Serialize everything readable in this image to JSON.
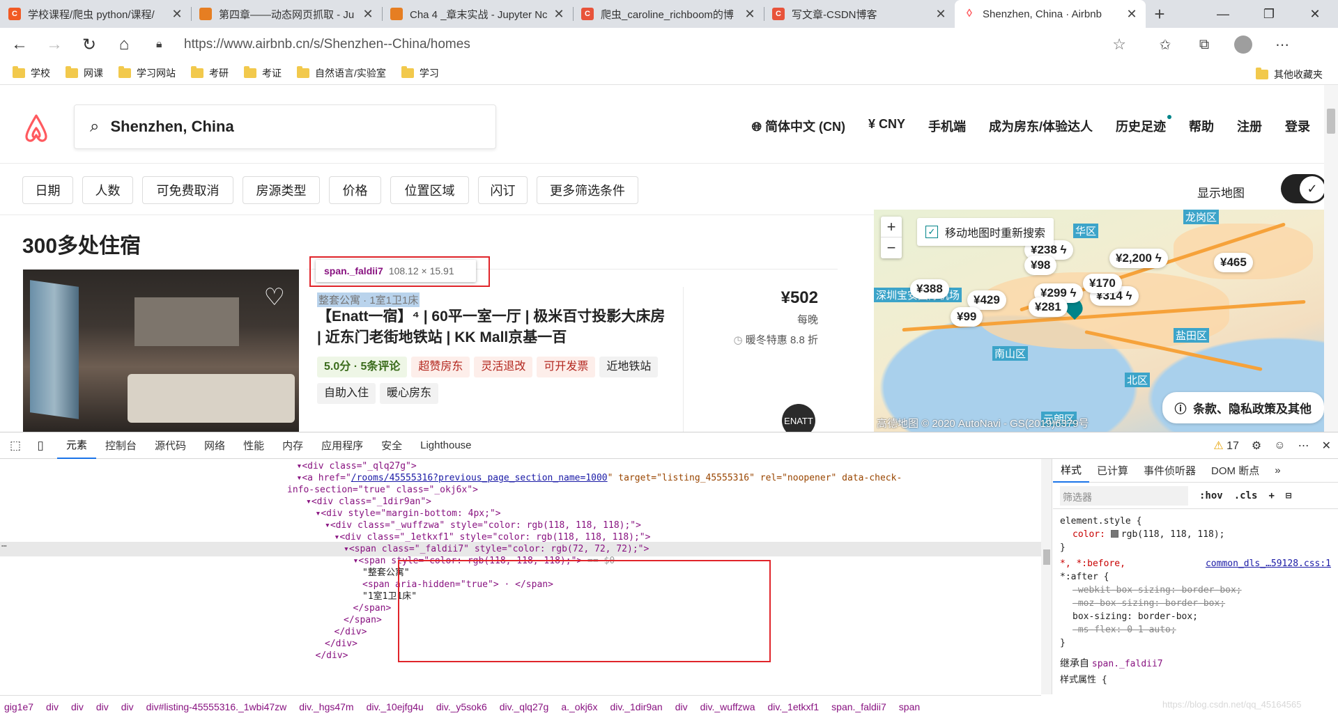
{
  "browser": {
    "tabs": [
      {
        "title": "学校课程/爬虫 python/课程/",
        "fav_color": "#f15a24",
        "fav_glyph": "C"
      },
      {
        "title": "第四章——动态网页抓取 - Ju",
        "fav_color": "#e67e22",
        "fav_glyph": ""
      },
      {
        "title": "Cha 4 _章末实战 - Jupyter Nc",
        "fav_color": "#e67e22",
        "fav_glyph": ""
      },
      {
        "title": "爬虫_caroline_richboom的博",
        "fav_color": "#e8533a",
        "fav_glyph": "C"
      },
      {
        "title": "写文章-CSDN博客",
        "fav_color": "#e8533a",
        "fav_glyph": "C"
      },
      {
        "title": "Shenzhen, China · Airbnb",
        "fav_color": "#ffffff",
        "fav_glyph": "◊"
      }
    ],
    "url": "https://www.airbnb.cn/s/Shenzhen--China/homes",
    "bookmarks": [
      "学校",
      "网课",
      "学习网站",
      "考研",
      "考证",
      "自然语言/实验室",
      "学习"
    ],
    "other_bookmarks": "其他收藏夹"
  },
  "airbnb": {
    "search_value": "Shenzhen, China",
    "nav": [
      "简体中文 (CN)",
      "¥ CNY",
      "手机端",
      "成为房东/体验达人",
      "历史足迹",
      "帮助",
      "注册",
      "登录"
    ],
    "filters": [
      "日期",
      "人数",
      "可免费取消",
      "房源类型",
      "价格",
      "位置区域",
      "闪订",
      "更多筛选条件"
    ],
    "show_map": "显示地图",
    "result_count": "300多处住宿",
    "tooltip": {
      "selector": "span._faldii7",
      "size": "108.12 × 15.91"
    },
    "listing": {
      "room_type": "整套公寓 · 1室1卫1床",
      "title": "【Enatt一宿】⁴ | 60平一室一厅 | 极米百寸投影大床房 | 近东门老街地铁站 | KK Mall京基一百",
      "tags": [
        "5.0分 · 5条评论",
        "超赞房东",
        "灵活退改",
        "可开发票",
        "近地铁站",
        "自助入住",
        "暖心房东"
      ],
      "price": "¥502",
      "per_night": "每晚",
      "discount": "暖冬特惠 8.8 折",
      "host_initials": "ENATT"
    },
    "map": {
      "move_search": "移动地图时重新搜索",
      "zoom_in": "+",
      "zoom_out": "−",
      "pins": [
        "¥238",
        "¥98",
        "¥2,200",
        "¥465",
        "¥388",
        "¥429",
        "¥299",
        "¥314",
        "¥99",
        "¥281",
        "¥170"
      ],
      "districts": [
        "华区",
        "龙岗区",
        "南山区",
        "盐田区",
        "北区",
        "元朗区",
        "深圳宝安国际机场"
      ],
      "terms": "条款、隐私政策及其他",
      "copyright": "高德地图 © 2020 AutoNavi - GS(2019)6379号"
    }
  },
  "devtools": {
    "tabs": [
      "元素",
      "控制台",
      "源代码",
      "网络",
      "性能",
      "内存",
      "应用程序",
      "安全",
      "Lighthouse"
    ],
    "warnings": "17",
    "dom_lines": [
      {
        "indent": 33,
        "html": "▾<div class=\"_qlq27g\">",
        "partial": true
      },
      {
        "indent": 33,
        "a_href": "/rooms/45555316?previous_page_section_name=1000",
        "a_rest_attrs": " target=\"listing_45555316\" rel=\"noopener\" data-check-"
      },
      {
        "indent": 32,
        "text": "info-section=\"true\" class=\"_okj6x\">"
      },
      {
        "indent": 34,
        "text": "▾<div class=\"_1dir9an\">"
      },
      {
        "indent": 35,
        "text": "▾<div style=\"margin-bottom: 4px;\">"
      },
      {
        "indent": 36,
        "text": "▾<div class=\"_wuffzwa\" style=\"color: rgb(118, 118, 118);\">"
      },
      {
        "indent": 37,
        "text": "▾<div class=\"_1etkxf1\" style=\"color: rgb(118, 118, 118);\">"
      },
      {
        "indent": 38,
        "text": "▾<span class=\"_faldii7\" style=\"color: rgb(72, 72, 72);\">"
      },
      {
        "indent": 39,
        "text": "▾<span style=\"color: rgb(118, 118, 118);\">",
        "suffix": " == $0"
      },
      {
        "indent": 40,
        "text": "\"整套公寓\""
      },
      {
        "indent": 40,
        "text": "<span aria-hidden=\"true\"> · </span>"
      },
      {
        "indent": 40,
        "text": "\"1室1卫1床\""
      },
      {
        "indent": 39,
        "text": "</span>"
      },
      {
        "indent": 38,
        "text": "</span>"
      },
      {
        "indent": 37,
        "text": "</div>"
      },
      {
        "indent": 36,
        "text": "</div>"
      },
      {
        "indent": 35,
        "text": "</div>"
      }
    ],
    "styles_tabs": [
      "样式",
      "已计算",
      "事件侦听器",
      "DOM 断点"
    ],
    "filter_placeholder": "筛选器",
    "hov": ":hov",
    "cls": ".cls",
    "element_style": "element.style {",
    "element_color": "color:",
    "element_color_val": "rgb(118, 118, 118);",
    "universal_selector": "*, *:before,",
    "universal_after": "*:after {",
    "source_link": "common_dls_…59128.css:1",
    "props": [
      "-webkit-box-sizing: border-box;",
      "-moz-box-sizing: border-box;",
      "box-sizing: border-box;",
      "-ms-flex: 0 1 auto;"
    ],
    "inherited_from": "继承自",
    "inherited_sel": "span._faldii7",
    "style_attr": "样式属性 {",
    "breadcrumbs": [
      "gig1e7",
      "div",
      "div",
      "div",
      "div",
      "div#listing-45555316._1wbi47zw",
      "div._hgs47m",
      "div._10ejfg4u",
      "div._y5sok6",
      "div._qlq27g",
      "a._okj6x",
      "div._1dir9an",
      "div",
      "div._wuffzwa",
      "div._1etkxf1",
      "span._faldii7",
      "span"
    ],
    "watermark": "https://blog.csdn.net/qq_45164565"
  }
}
